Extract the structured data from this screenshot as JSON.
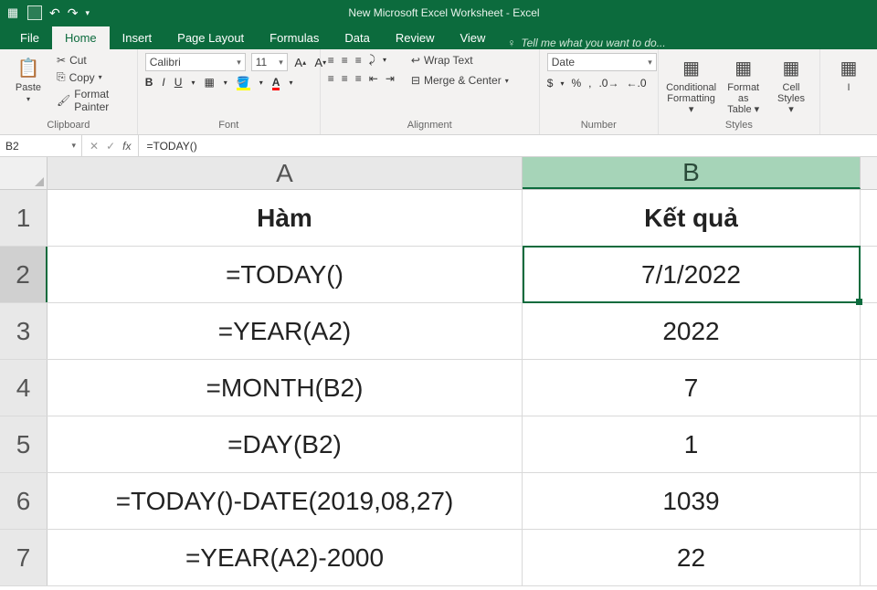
{
  "app": {
    "title": "New Microsoft Excel Worksheet - Excel"
  },
  "tabs": {
    "file": "File",
    "home": "Home",
    "insert": "Insert",
    "pagelayout": "Page Layout",
    "formulas": "Formulas",
    "data": "Data",
    "review": "Review",
    "view": "View",
    "tellme": "Tell me what you want to do..."
  },
  "ribbon": {
    "clipboard": {
      "paste": "Paste",
      "cut": "Cut",
      "copy": "Copy",
      "formatpainter": "Format Painter",
      "label": "Clipboard"
    },
    "font": {
      "name": "Calibri",
      "size": "11",
      "label": "Font"
    },
    "alignment": {
      "wrap": "Wrap Text",
      "merge": "Merge & Center",
      "label": "Alignment"
    },
    "number": {
      "format": "Date",
      "label": "Number"
    },
    "styles": {
      "cond": "Conditional Formatting",
      "table": "Format as Table",
      "cellstyles": "Cell Styles",
      "label": "Styles"
    }
  },
  "namebox": "B2",
  "formula": "=TODAY()",
  "columns": {
    "A": "A",
    "B": "B"
  },
  "rows": {
    "r1": {
      "n": "1",
      "A": "Hàm",
      "B": "Kết quả"
    },
    "r2": {
      "n": "2",
      "A": "=TODAY()",
      "B": "7/1/2022"
    },
    "r3": {
      "n": "3",
      "A": "=YEAR(A2)",
      "B": "2022"
    },
    "r4": {
      "n": "4",
      "A": "=MONTH(B2)",
      "B": "7"
    },
    "r5": {
      "n": "5",
      "A": "=DAY(B2)",
      "B": "1"
    },
    "r6": {
      "n": "6",
      "A": "=TODAY()-DATE(2019,08,27)",
      "B": "1039"
    },
    "r7": {
      "n": "7",
      "A": "=YEAR(A2)-2000",
      "B": "22"
    }
  }
}
